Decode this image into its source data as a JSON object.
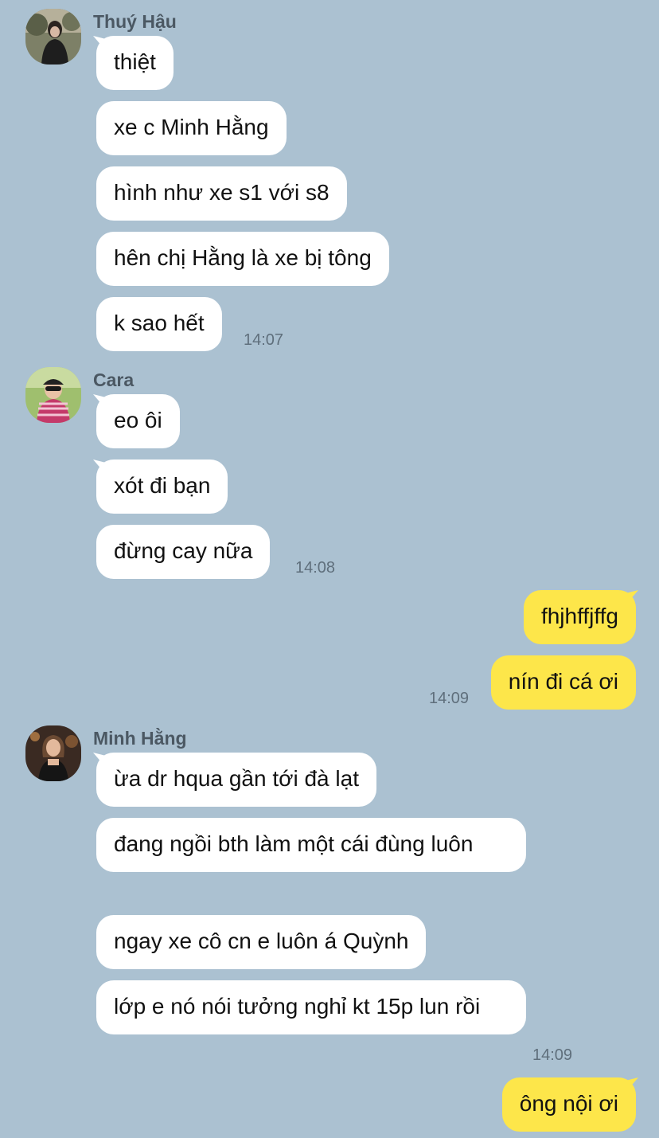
{
  "groups": [
    {
      "sender": "Thuý Hậu",
      "avatar_icon": "avatar-photo",
      "messages": [
        "thiệt",
        "xe c Minh Hằng",
        "hình như xe s1 với s8",
        "hên chị Hằng là xe bị tông",
        "k sao hết"
      ],
      "time": "14:07"
    },
    {
      "sender": "Cara",
      "avatar_icon": "avatar-photo",
      "messages": [
        "eo ôi",
        "xót đi bạn",
        "đừng cay nữa"
      ],
      "time": "14:08"
    },
    {
      "sender": "",
      "outgoing": true,
      "messages": [
        "fhjhffjffg",
        "nín đi cá ơi"
      ],
      "time": "14:09"
    },
    {
      "sender": "Minh Hằng",
      "avatar_icon": "avatar-photo",
      "messages": [
        "ừa dr hqua gần tới đà lạt",
        "đang ngồi bth làm một cái đùng luôn",
        "ngay xe cô cn e luôn á Quỳnh",
        "lớp e nó nói tưởng nghỉ kt 15p lun rồi"
      ],
      "time": "14:09"
    },
    {
      "sender": "",
      "outgoing": true,
      "messages": [
        "ông nội ơi"
      ],
      "time": ""
    }
  ],
  "colors": {
    "background": "#abc1d1",
    "incoming_bubble": "#ffffff",
    "outgoing_bubble": "#fde64a"
  }
}
